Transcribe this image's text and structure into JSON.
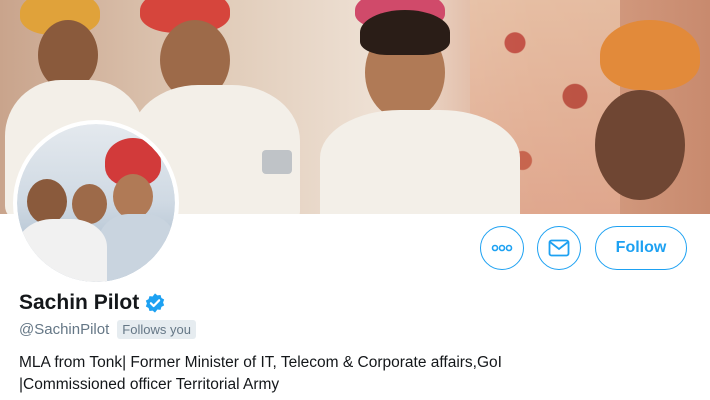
{
  "profile": {
    "name": "Sachin Pilot",
    "handle": "@SachinPilot",
    "follows_you": "Follows you",
    "bio_line1": "MLA from Tonk| Former Minister of IT, Telecom & Corporate affairs,GoI",
    "bio_line2": "|Commissioned officer Territorial Army"
  },
  "actions": {
    "more_icon": "more-icon",
    "message_icon": "mail-icon",
    "follow_label": "Follow"
  },
  "colors": {
    "accent": "#1da1f2",
    "verified": "#1da1f2",
    "text_primary": "#14171a",
    "text_secondary": "#657786"
  }
}
